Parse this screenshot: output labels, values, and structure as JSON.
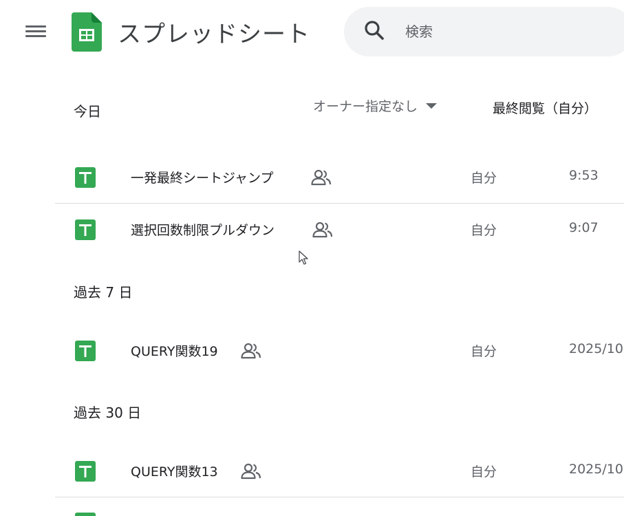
{
  "header": {
    "app_title": "スプレッドシート",
    "search_placeholder": "検索"
  },
  "columns": {
    "owner_filter": "オーナー指定なし",
    "sort_label": "最終閲覧（自分）"
  },
  "sections": [
    {
      "heading": "今日",
      "files": [
        {
          "name": "一発最終シートジャンプ",
          "owner": "自分",
          "date": "9:53",
          "shared": true
        },
        {
          "name": "選択回数制限プルダウン",
          "owner": "自分",
          "date": "9:07",
          "shared": true
        }
      ]
    },
    {
      "heading": "過去 7 日",
      "files": [
        {
          "name": "QUERY関数19",
          "owner": "自分",
          "date": "2025/10",
          "shared": true
        }
      ]
    },
    {
      "heading": "過去 30 日",
      "files": [
        {
          "name": "QUERY関数13",
          "owner": "自分",
          "date": "2025/10",
          "shared": true
        }
      ]
    }
  ],
  "colors": {
    "sheets_green": "#34a853",
    "sheets_green_dark": "#188038",
    "search_bg": "#f1f3f4",
    "divider": "#dadce0",
    "secondary_text": "#5f6368"
  },
  "icons": {
    "menu": "hamburger-menu-icon",
    "logo": "sheets-logo-icon",
    "search": "search-icon",
    "file": "spreadsheet-file-icon",
    "shared": "shared-people-icon",
    "dropdown": "caret-down-icon"
  }
}
